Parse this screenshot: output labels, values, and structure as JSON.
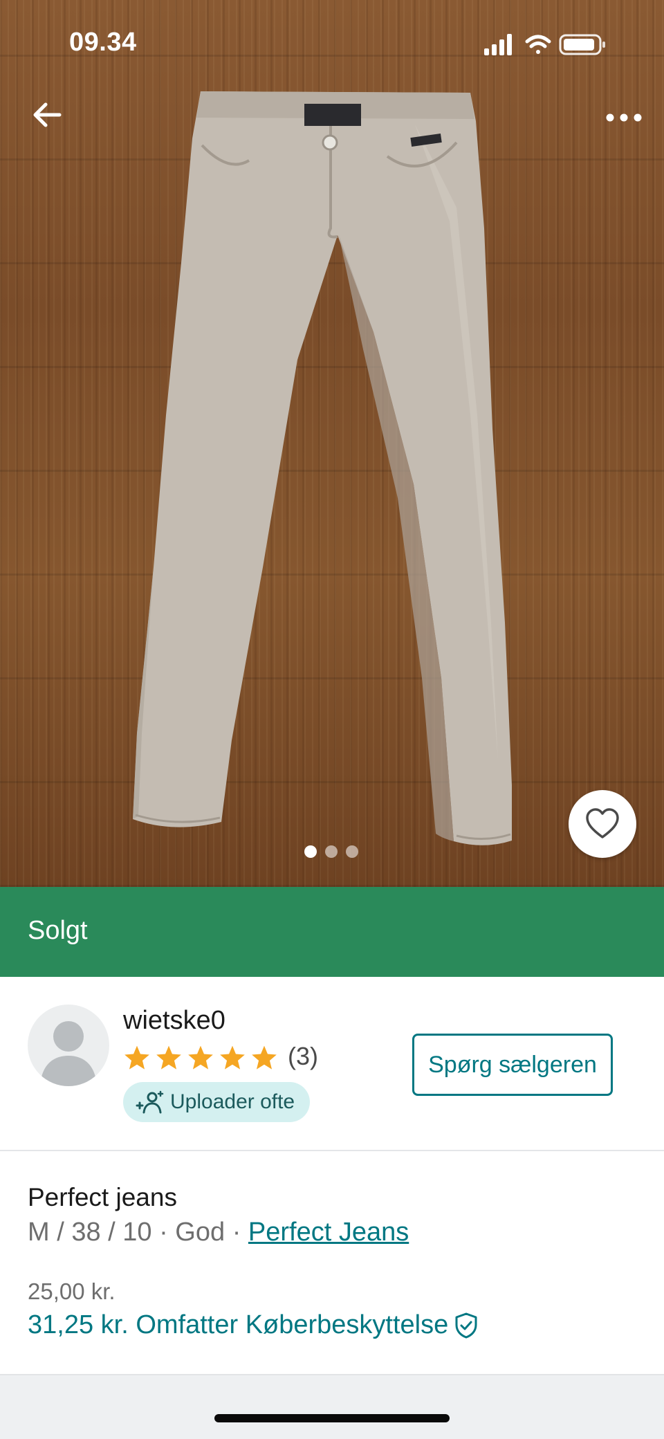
{
  "status_bar": {
    "time": "09.34"
  },
  "header": {
    "back_icon": "arrow-left-icon",
    "more_icon": "more-horizontal-icon"
  },
  "gallery": {
    "photo_count": 3,
    "active_index": 0,
    "favorite_icon": "heart-outline-icon"
  },
  "status_banner": {
    "label": "Solgt",
    "color": "#2a8a5a"
  },
  "seller": {
    "username": "wietske0",
    "rating_stars": 5,
    "review_count": "(3)",
    "badge_label": "Uploader ofte",
    "badge_icon": "frequent-uploader-icon",
    "ask_button_label": "Spørg sælgeren"
  },
  "item": {
    "title": "Perfect jeans",
    "meta": "M / 38 / 10 · God · ",
    "brand": "Perfect Jeans",
    "price": "25,00 kr.",
    "total_price": "31,25 kr. Omfatter Køberbeskyttelse",
    "protection_icon": "shield-check-icon"
  },
  "colors": {
    "accent": "#007782",
    "star": "#f5a623",
    "badge_bg": "#d4f0f0"
  }
}
